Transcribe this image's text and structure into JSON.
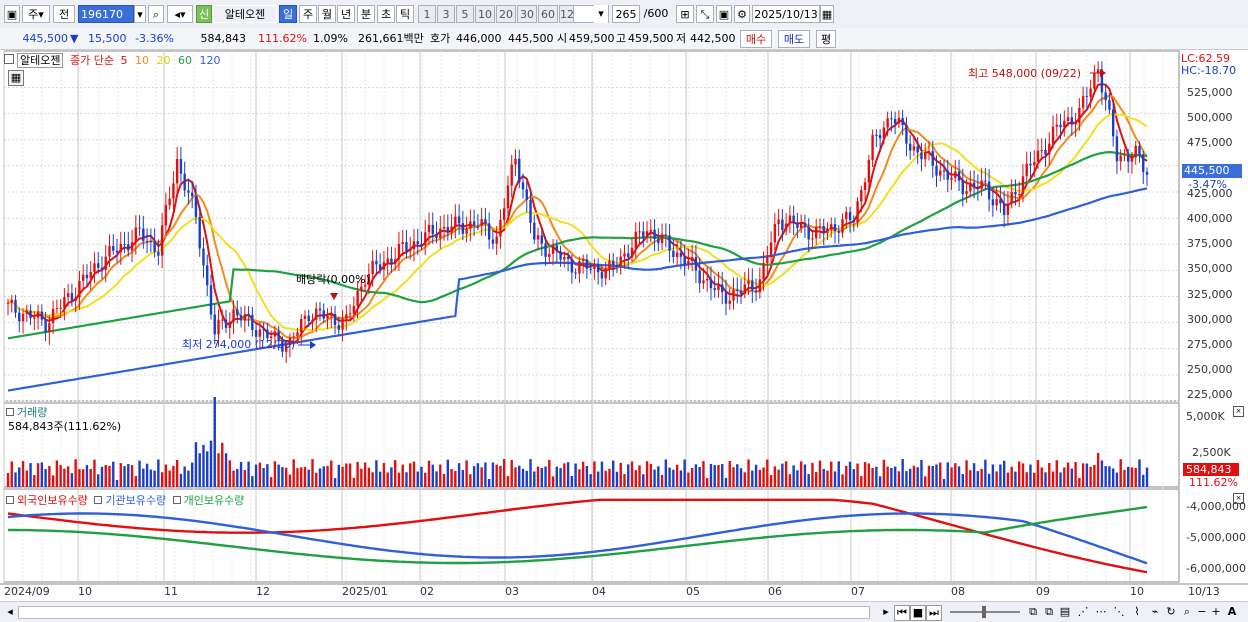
{
  "toolbar": {
    "period_label": "주",
    "prev_label": "전",
    "code": "196170",
    "new_badge": "신",
    "stock_name": "알테오젠",
    "timeframes": [
      "일",
      "주",
      "월",
      "년",
      "분",
      "초",
      "틱"
    ],
    "intervals": [
      "1",
      "3",
      "5",
      "10",
      "20",
      "30",
      "60",
      "120"
    ],
    "count": "265",
    "count_total": "/600",
    "date": "2025/10/13"
  },
  "infobar": {
    "price": "445,500",
    "change_arrow": "▼",
    "change": "15,500",
    "change_pct": "-3.36%",
    "volume": "584,843",
    "volume_ratio": "111.62%",
    "turnover_pct": "1.09%",
    "amount": "261,661백만",
    "quote_label": "호가",
    "bid": "446,000",
    "ask": "445,500",
    "open_label": "시",
    "open": "459,500",
    "high_label": "고",
    "high": "459,500",
    "low_label": "저",
    "low": "442,500",
    "buy_label": "매수",
    "sell_label": "매도",
    "eval_label": "평"
  },
  "main_panel": {
    "name": "알테오젠",
    "ma_prefix": "종가 단순",
    "ma_periods": [
      "5",
      "10",
      "20",
      "60",
      "120"
    ],
    "ma_colors": [
      "#e01010",
      "#f08c1c",
      "#f0e020",
      "#20a040",
      "#3060d8"
    ],
    "lc": "LC:62.59",
    "hc": "HC:-18.70",
    "annotations": {
      "high": "최고 548,000 (09/22)",
      "low": "최저 274,000 (12/20)",
      "dividend": "배당락(0.00%)"
    },
    "current_price": "445,500",
    "current_pct": "-3.47%",
    "yaxis": [
      "525,000",
      "500,000",
      "475,000",
      "450,000",
      "425,000",
      "400,000",
      "375,000",
      "350,000",
      "325,000",
      "300,000",
      "275,000",
      "250,000",
      "225,000"
    ]
  },
  "volume_panel": {
    "title": "거래량",
    "value": "584,843주(111.62%)",
    "yaxis": [
      "5,000K",
      "2,500K"
    ],
    "badge": "584,843",
    "badge_pct": "111.62%"
  },
  "investor_panel": {
    "series": [
      "외국인보유수량",
      "기관보유수량",
      "개인보유수량"
    ],
    "colors": [
      "#e01010",
      "#3060d8",
      "#20a040"
    ],
    "yaxis": [
      "-4,000,000",
      "-5,000,000",
      "-6,000,000"
    ]
  },
  "xaxis": [
    "2024/09",
    "10",
    "11",
    "12",
    "2025/01",
    "02",
    "03",
    "04",
    "05",
    "06",
    "07",
    "08",
    "09",
    "10"
  ],
  "xaxis_right": "10/13",
  "chart_data": {
    "type": "candlestick",
    "ylim": [
      225000,
      560000
    ],
    "months": [
      "2024/09",
      "10",
      "11",
      "12",
      "2025/01",
      "02",
      "03",
      "04",
      "05",
      "06",
      "07",
      "08",
      "09",
      "10"
    ],
    "close_path_approx": [
      [
        0,
        315000
      ],
      [
        10,
        300000
      ],
      [
        25,
        360000
      ],
      [
        35,
        385000
      ],
      [
        40,
        370000
      ],
      [
        45,
        455000
      ],
      [
        50,
        400000
      ],
      [
        55,
        290000
      ],
      [
        60,
        310000
      ],
      [
        70,
        285000
      ],
      [
        75,
        280000
      ],
      [
        80,
        310000
      ],
      [
        90,
        300000
      ],
      [
        95,
        345000
      ],
      [
        105,
        370000
      ],
      [
        115,
        390000
      ],
      [
        125,
        395000
      ],
      [
        130,
        380000
      ],
      [
        135,
        460000
      ],
      [
        140,
        380000
      ],
      [
        150,
        355000
      ],
      [
        160,
        350000
      ],
      [
        170,
        390000
      ],
      [
        180,
        360000
      ],
      [
        190,
        325000
      ],
      [
        195,
        330000
      ],
      [
        200,
        340000
      ],
      [
        205,
        400000
      ],
      [
        215,
        385000
      ],
      [
        225,
        400000
      ],
      [
        230,
        470000
      ],
      [
        235,
        500000
      ],
      [
        240,
        470000
      ],
      [
        250,
        440000
      ],
      [
        255,
        430000
      ],
      [
        260,
        430000
      ],
      [
        265,
        405000
      ],
      [
        270,
        440000
      ],
      [
        280,
        490000
      ],
      [
        285,
        500000
      ],
      [
        290,
        545000
      ],
      [
        295,
        460000
      ],
      [
        300,
        460000
      ],
      [
        303,
        445500
      ]
    ],
    "high": {
      "value": 548000,
      "date": "09/22"
    },
    "low": {
      "value": 274000,
      "date": "12/20"
    }
  }
}
